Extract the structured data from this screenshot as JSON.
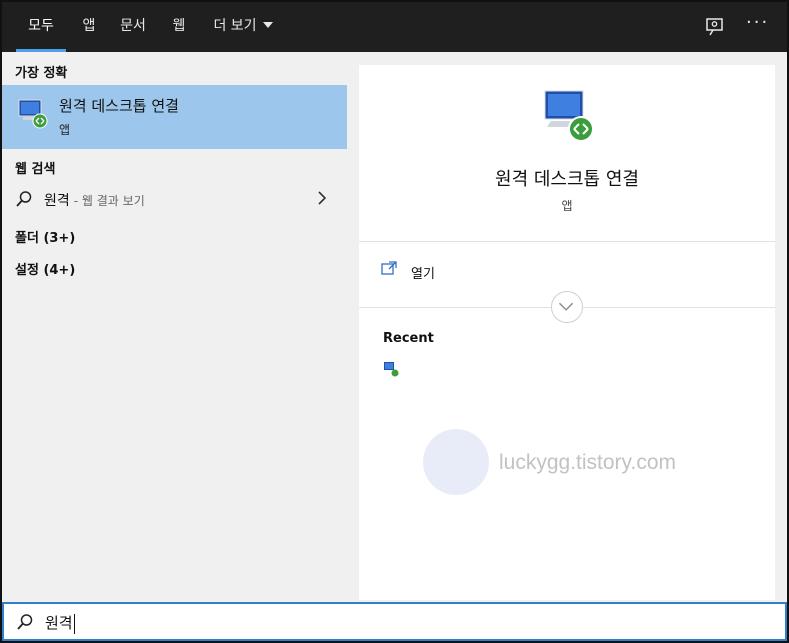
{
  "tabs": [
    {
      "label": "모두",
      "active": true
    },
    {
      "label": "앱"
    },
    {
      "label": "문서"
    },
    {
      "label": "웹"
    },
    {
      "label": "더 보기"
    }
  ],
  "left": {
    "best_match_heading": "가장 정확",
    "best_match": {
      "title": "원격 데스크톱 연결",
      "subtitle": "앱",
      "icon": "remote-desktop-icon"
    },
    "web_heading": "웹 검색",
    "web_query": "원격",
    "web_hint": "- 웹 결과 보기",
    "folders_heading": "폴더 (3+)",
    "settings_heading": "설정 (4+)"
  },
  "right": {
    "app_name": "원격 데스크톱 연결",
    "app_type": "앱",
    "open_label": "열기",
    "recent_heading": "Recent"
  },
  "watermark": {
    "text": "luckygg.tistory.com"
  },
  "search": {
    "value": "원격"
  },
  "colors": {
    "accent": "#4c9fe8",
    "selected": "#9dc6ec",
    "topbar": "#1f1f1f",
    "search_border": "#2f7fd1"
  }
}
